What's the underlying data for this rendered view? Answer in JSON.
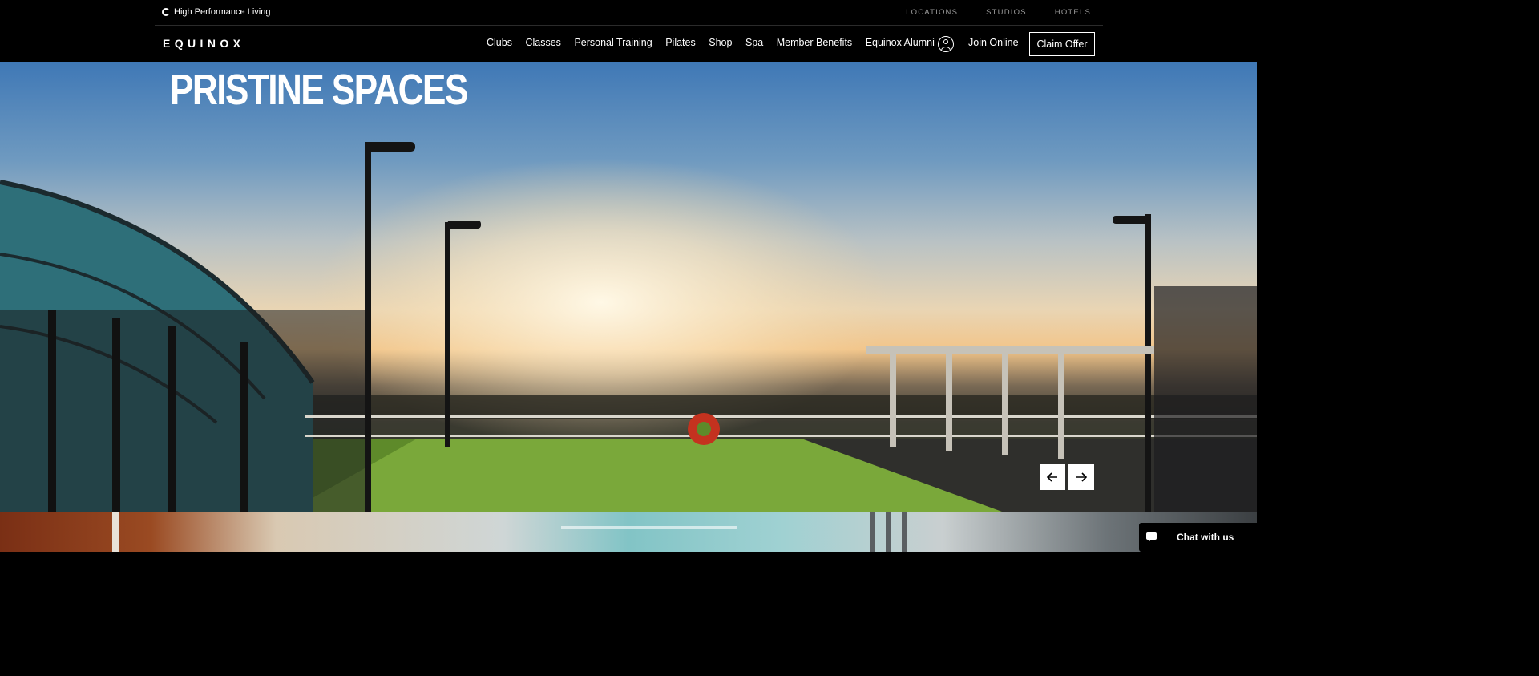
{
  "topbar": {
    "tagline": "High Performance Living",
    "links": [
      "LOCATIONS",
      "STUDIOS",
      "HOTELS"
    ]
  },
  "nav": {
    "logo": "EQUINOX",
    "items": [
      "Clubs",
      "Classes",
      "Personal Training",
      "Pilates",
      "Shop",
      "Spa",
      "Member Benefits",
      "Equinox Alumni"
    ],
    "join_label": "Join Online",
    "claim_label": "Claim Offer"
  },
  "hero": {
    "title": "PRISTINE SPACES"
  },
  "chat": {
    "label": "Chat with us"
  },
  "colors": {
    "background": "#000000",
    "button_bg": "#ffffff",
    "text": "#ffffff"
  },
  "icons": {
    "user": "user-circle-icon",
    "prev": "arrow-left-icon",
    "next": "arrow-right-icon",
    "chat": "chat-bubble-icon",
    "tagline": "ring-icon"
  }
}
